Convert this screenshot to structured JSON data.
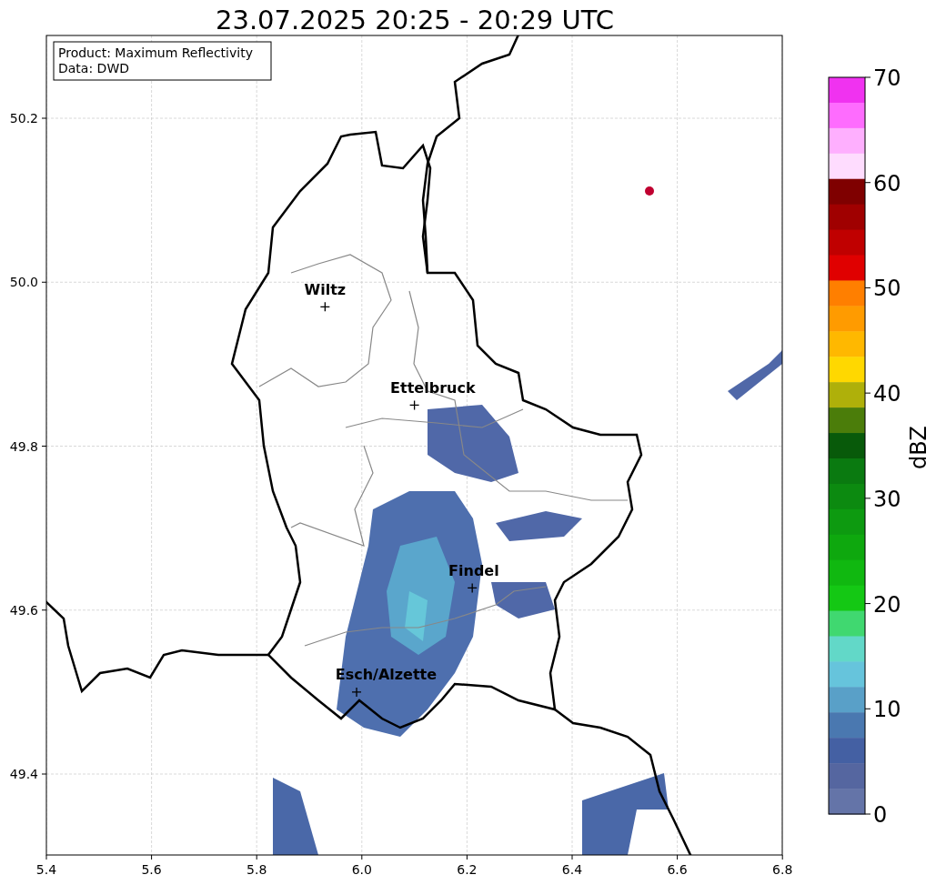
{
  "title": "23.07.2025 20:25 - 20:29 UTC",
  "legend": [
    "Product: Maximum Reflectivity",
    "Data: DWD"
  ],
  "x_ticks": [
    "5.4",
    "5.6",
    "5.8",
    "6.0",
    "6.2",
    "6.4",
    "6.6",
    "6.8"
  ],
  "y_ticks": [
    "50.2",
    "50.0",
    "49.8",
    "49.6",
    "49.4"
  ],
  "cities": [
    {
      "name": "Wiltz"
    },
    {
      "name": "Ettelbruck"
    },
    {
      "name": "Findel"
    },
    {
      "name": "Esch/Alzette"
    }
  ],
  "colorbar": {
    "label": "dBZ",
    "ticks": [
      "70",
      "60",
      "50",
      "40",
      "30",
      "20",
      "10",
      "0"
    ],
    "bins": [
      {
        "color": "#f032f0"
      },
      {
        "color": "#fe6cfe"
      },
      {
        "color": "#feaffe"
      },
      {
        "color": "#fedcfe"
      },
      {
        "color": "#7f0000"
      },
      {
        "color": "#a00000"
      },
      {
        "color": "#c00000"
      },
      {
        "color": "#e00000"
      },
      {
        "color": "#ff7f00"
      },
      {
        "color": "#ff9b00"
      },
      {
        "color": "#ffb800"
      },
      {
        "color": "#ffd800"
      },
      {
        "color": "#afb00a"
      },
      {
        "color": "#4b7d0a"
      },
      {
        "color": "#085a0a"
      },
      {
        "color": "#0a7a10"
      },
      {
        "color": "#0c8a10"
      },
      {
        "color": "#0d9a10"
      },
      {
        "color": "#0ea80e"
      },
      {
        "color": "#10b810"
      },
      {
        "color": "#14c814"
      },
      {
        "color": "#40d870"
      },
      {
        "color": "#62d8c8"
      },
      {
        "color": "#66c4dc"
      },
      {
        "color": "#59a0c8"
      },
      {
        "color": "#4a78b0"
      },
      {
        "color": "#4460a3"
      },
      {
        "color": "#5566a0"
      },
      {
        "color": "#6474a8"
      }
    ]
  }
}
